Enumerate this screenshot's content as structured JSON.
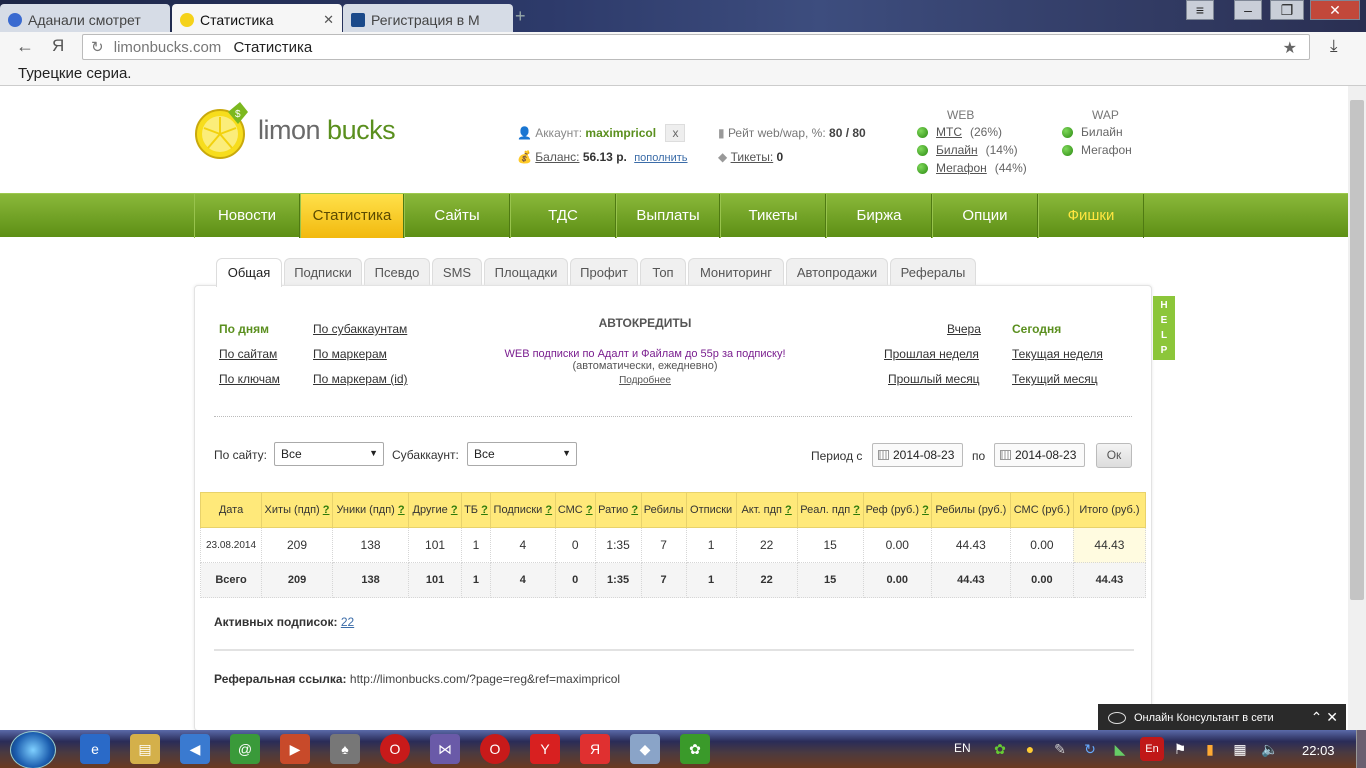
{
  "browser": {
    "tabs": [
      {
        "title": "Аданали смотрет"
      },
      {
        "title": "Статистика"
      },
      {
        "title": "Регистрация в М"
      }
    ],
    "url_host": "limonbucks.com",
    "url_title": "Статистика",
    "bookmark": "Турецкие сериа."
  },
  "header": {
    "logo_text_1": "limon",
    "logo_text_2": "bucks",
    "account_label": "Аккаунт:",
    "account_name": "maximpricol",
    "account_close": "x",
    "balance_label": "Баланс:",
    "balance_value": "56.13 р.",
    "balance_topup": "пополнить",
    "rate_label": "Рейт web/wap, %:",
    "rate_value": "80 / 80",
    "tickets_label": "Тикеты:",
    "tickets_value": "0",
    "web_head": "WEB",
    "wap_head": "WAP",
    "web_ops": [
      {
        "name": "МТС",
        "pct": "(26%)"
      },
      {
        "name": "Билайн",
        "pct": "(14%)"
      },
      {
        "name": "Мегафон",
        "pct": "(44%)"
      }
    ],
    "wap_ops": [
      {
        "name": "Билайн"
      },
      {
        "name": "Мегафон"
      }
    ]
  },
  "menu": [
    "Новости",
    "Статистика",
    "Сайты",
    "ТДС",
    "Выплаты",
    "Тикеты",
    "Биржа",
    "Опции",
    "Фишки"
  ],
  "subtabs": [
    "Общая",
    "Подписки",
    "Псевдо",
    "SMS",
    "Площадки",
    "Профит",
    "Топ",
    "Мониторинг",
    "Автопродажи",
    "Рефералы"
  ],
  "help": "HELP",
  "links": {
    "by_days": "По дням",
    "by_sites": "По сайтам",
    "by_keys": "По ключам",
    "by_subacc": "По субаккаунтам",
    "by_markers": "По маркерам",
    "by_markers_id": "По маркерам (id)",
    "yesterday": "Вчера",
    "today": "Сегодня",
    "last_week": "Прошлая неделя",
    "cur_week": "Текущая неделя",
    "last_month": "Прошлый месяц",
    "cur_month": "Текущий месяц"
  },
  "promo": {
    "title": "АВТОКРЕДИТЫ",
    "text": "WEB подписки по Адалт и Файлам до 55р за подписку!",
    "sub": "(автоматически, ежедневно)",
    "more": "Подробнее"
  },
  "filters": {
    "site_label": "По сайту:",
    "site_value": "Все",
    "subacc_label": "Субаккаунт:",
    "subacc_value": "Все",
    "period_label": "Период с",
    "date_from": "2014-08-23",
    "to_label": "по",
    "date_to": "2014-08-23",
    "ok": "Ок"
  },
  "table": {
    "headers": [
      {
        "t": "Дата",
        "q": ""
      },
      {
        "t": "Хиты (пдп)",
        "q": "?"
      },
      {
        "t": "Уники (пдп)",
        "q": "?"
      },
      {
        "t": "Другие",
        "q": "?"
      },
      {
        "t": "ТБ",
        "q": "?"
      },
      {
        "t": "Подписки",
        "q": "?"
      },
      {
        "t": "СМС",
        "q": "?"
      },
      {
        "t": "Ратио",
        "q": "?"
      },
      {
        "t": "Ребилы",
        "q": ""
      },
      {
        "t": "Отписки",
        "q": ""
      },
      {
        "t": "Акт. пдп",
        "q": "?"
      },
      {
        "t": "Реал. пдп",
        "q": "?"
      },
      {
        "t": "Реф (руб.)",
        "q": "?"
      },
      {
        "t": "Ребилы (руб.)",
        "q": ""
      },
      {
        "t": "СМС (руб.)",
        "q": ""
      },
      {
        "t": "Итого (руб.)",
        "q": ""
      }
    ],
    "rows": [
      [
        "23.08.2014",
        "209",
        "138",
        "101",
        "1",
        "4",
        "0",
        "1:35",
        "7",
        "1",
        "22",
        "15",
        "0.00",
        "44.43",
        "0.00",
        "44.43"
      ]
    ],
    "total": [
      "Всего",
      "209",
      "138",
      "101",
      "1",
      "4",
      "0",
      "1:35",
      "7",
      "1",
      "22",
      "15",
      "0.00",
      "44.43",
      "0.00",
      "44.43"
    ]
  },
  "active_subs_label": "Активных подписок:",
  "active_subs_value": "22",
  "ref_label": "Реферальная ссылка:",
  "ref_url": "http://limonbucks.com/?page=reg&ref=maximpricol",
  "chat_text": "Онлайн Консультант в сети",
  "taskbar": {
    "lang": "EN",
    "clock": "22:03",
    "en_badge": "En"
  }
}
